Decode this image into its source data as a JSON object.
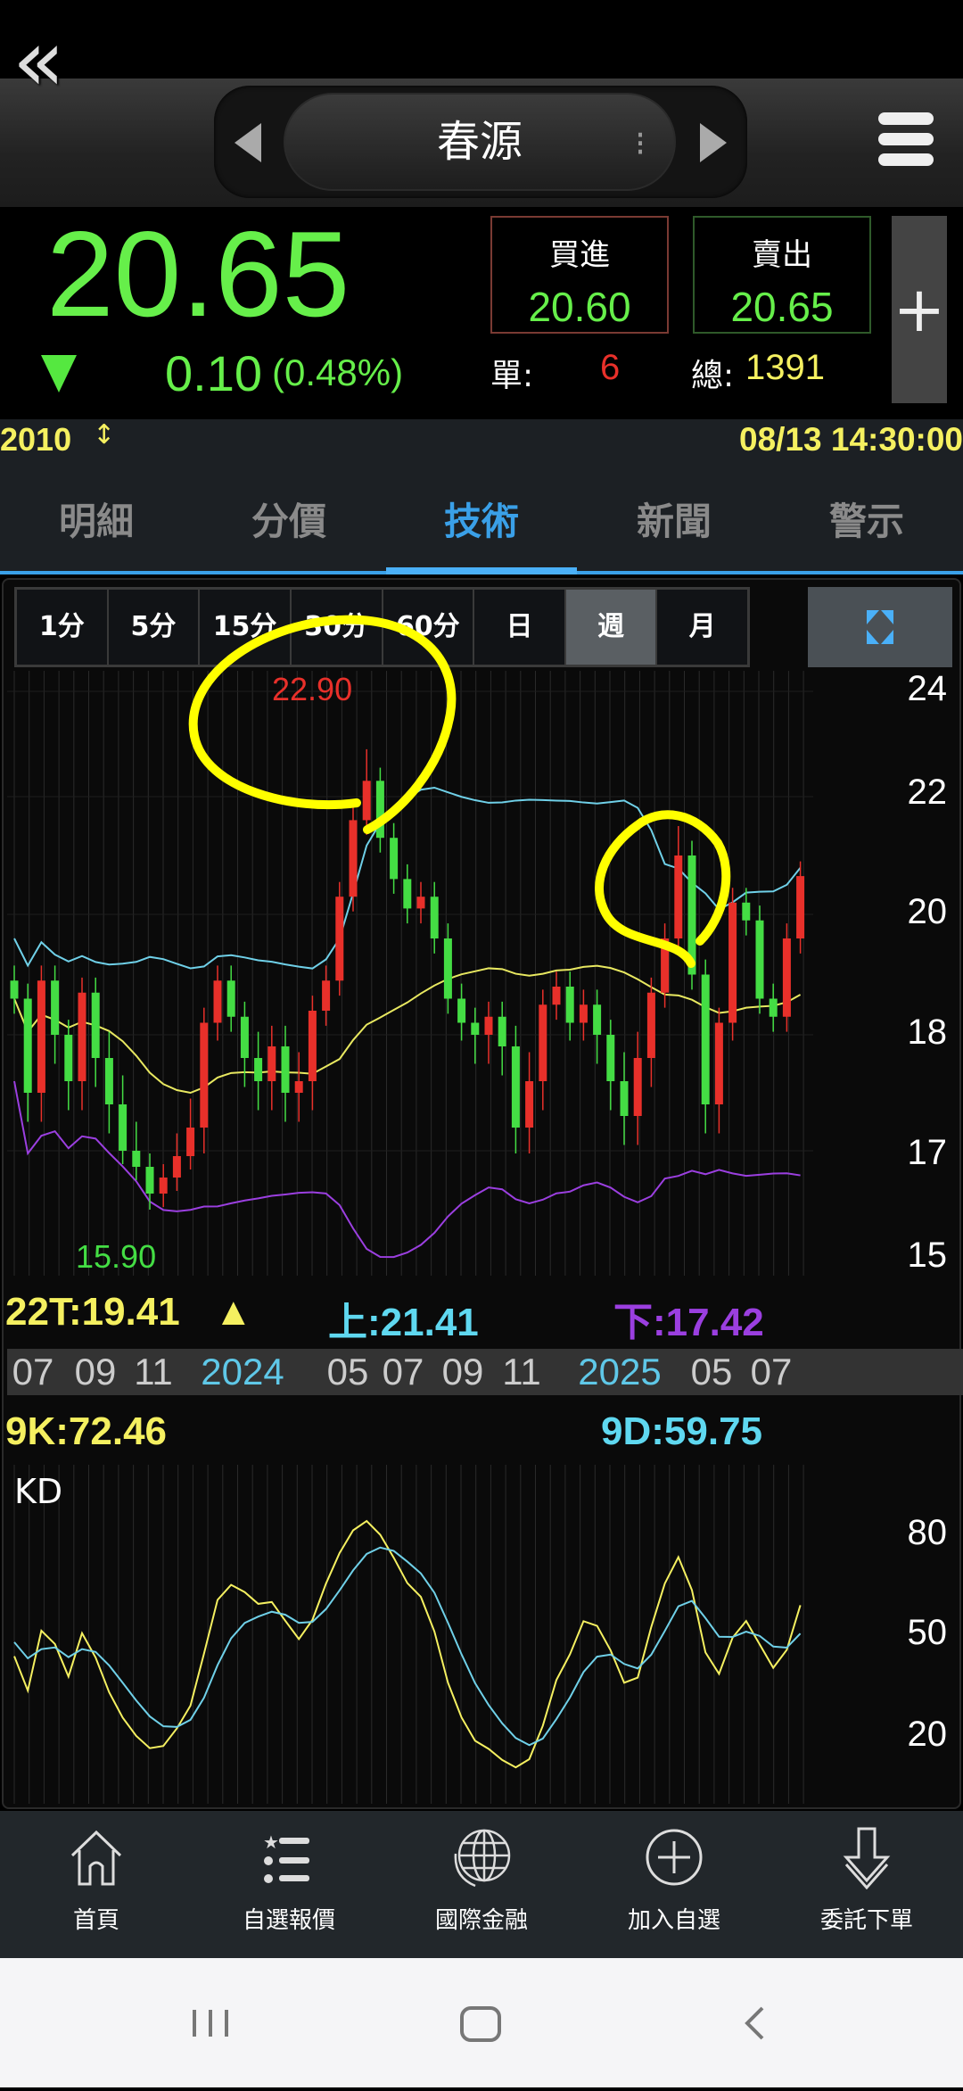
{
  "header": {
    "title": "春源"
  },
  "quote": {
    "price": "20.65",
    "change": "0.10",
    "change_pct": "(0.48%)",
    "bid_label": "買進",
    "bid": "20.60",
    "ask_label": "賣出",
    "ask": "20.65",
    "unit_label": "單:",
    "unit_value": "6",
    "total_label": "總:",
    "total_value": "1391",
    "plus": "+"
  },
  "info": {
    "code": "2010",
    "datetime": "08/13 14:30:00"
  },
  "tabs": [
    {
      "label": "明細"
    },
    {
      "label": "分價"
    },
    {
      "label": "技術",
      "active": true
    },
    {
      "label": "新聞"
    },
    {
      "label": "警示"
    }
  ],
  "timeframes": [
    {
      "label": "1分"
    },
    {
      "label": "5分"
    },
    {
      "label": "15分"
    },
    {
      "label": "30分"
    },
    {
      "label": "60分"
    },
    {
      "label": "日"
    },
    {
      "label": "週",
      "active": true
    },
    {
      "label": "月"
    }
  ],
  "indicators": {
    "ma": "22T:19.41",
    "upper": "上:21.41",
    "lower": "下:17.42",
    "k": "9K:72.46",
    "d": "9D:59.75",
    "kd_title": "KD"
  },
  "colors": {
    "up": "#e8302a",
    "down": "#44dd44",
    "upper": "#6fd0e8",
    "mid": "#e8e860",
    "lower": "#9b3fe0",
    "k": "#f5f060",
    "d": "#6fd0e8",
    "annotation": "#ffff00"
  },
  "chart_data": {
    "type": "candlestick",
    "title": "春源 週線",
    "y_ticks": [
      "24",
      "22",
      "20",
      "18",
      "17",
      "15"
    ],
    "x_ticks": [
      "07",
      "09",
      "11",
      "2024",
      "05",
      "07",
      "09",
      "11",
      "2025",
      "05",
      "07"
    ],
    "closes": [
      18.6,
      17.5,
      18.9,
      18.0,
      17.6,
      18.7,
      17.8,
      17.4,
      17.0,
      16.7,
      16.2,
      16.5,
      16.9,
      17.2,
      18.2,
      18.9,
      18.3,
      17.8,
      17.6,
      17.9,
      17.5,
      17.6,
      18.4,
      18.9,
      20.3,
      21.6,
      22.3,
      21.3,
      20.6,
      20.1,
      20.3,
      19.6,
      18.6,
      18.2,
      18.0,
      18.3,
      17.9,
      17.2,
      17.6,
      18.5,
      18.8,
      18.2,
      18.5,
      18.0,
      17.6,
      17.3,
      17.8,
      18.7,
      19.6,
      21.0,
      19.0,
      17.4,
      18.2,
      20.2,
      19.9,
      18.6,
      18.3,
      19.6,
      20.65
    ],
    "max_label": "22.90",
    "min_label": "15.90",
    "kd_ticks": [
      "80",
      "50",
      "20"
    ]
  },
  "bottom_nav": [
    {
      "label": "首頁",
      "icon": "home-icon"
    },
    {
      "label": "自選報價",
      "icon": "watchlist-icon"
    },
    {
      "label": "國際金融",
      "icon": "globe-icon"
    },
    {
      "label": "加入自選",
      "icon": "add-circle-icon"
    },
    {
      "label": "委託下單",
      "icon": "order-down-icon"
    }
  ]
}
